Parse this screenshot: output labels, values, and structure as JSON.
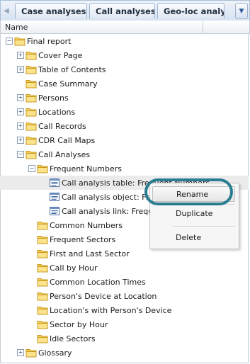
{
  "tabs": [
    {
      "label": "Case analyses"
    },
    {
      "label": "Call analyses"
    },
    {
      "label": "Geo-loc analyses"
    }
  ],
  "column_header": {
    "name": "Name"
  },
  "tree": [
    {
      "label": "Final report",
      "type": "folder",
      "depth": 0,
      "expander": "-"
    },
    {
      "label": "Cover Page",
      "type": "folder",
      "depth": 1,
      "expander": "+"
    },
    {
      "label": "Table of Contents",
      "type": "folder",
      "depth": 1,
      "expander": "+"
    },
    {
      "label": "Case Summary",
      "type": "folder",
      "depth": 1,
      "expander": ""
    },
    {
      "label": "Persons",
      "type": "folder",
      "depth": 1,
      "expander": "+"
    },
    {
      "label": "Locations",
      "type": "folder",
      "depth": 1,
      "expander": "+"
    },
    {
      "label": "Call Records",
      "type": "folder",
      "depth": 1,
      "expander": "+"
    },
    {
      "label": "CDR Call Maps",
      "type": "folder",
      "depth": 1,
      "expander": "+"
    },
    {
      "label": "Call Analyses",
      "type": "folder",
      "depth": 1,
      "expander": "-"
    },
    {
      "label": "Frequent Numbers",
      "type": "folder",
      "depth": 2,
      "expander": "-"
    },
    {
      "label": "Call analysis table: Frequent Numbers",
      "type": "doc",
      "depth": 3,
      "expander": "",
      "selected": true
    },
    {
      "label": "Call analysis object: Frequent Numbers",
      "type": "doc",
      "depth": 3,
      "expander": ""
    },
    {
      "label": "Call analysis link: Frequent Numbers",
      "type": "doc",
      "depth": 3,
      "expander": ""
    },
    {
      "label": "Common Numbers",
      "type": "folder",
      "depth": 2,
      "expander": ""
    },
    {
      "label": "Frequent Sectors",
      "type": "folder",
      "depth": 2,
      "expander": ""
    },
    {
      "label": "First and Last Sector",
      "type": "folder",
      "depth": 2,
      "expander": ""
    },
    {
      "label": "Call by Hour",
      "type": "folder",
      "depth": 2,
      "expander": ""
    },
    {
      "label": "Common Location Times",
      "type": "folder",
      "depth": 2,
      "expander": ""
    },
    {
      "label": "Person's Device at Location",
      "type": "folder",
      "depth": 2,
      "expander": ""
    },
    {
      "label": "Location's with Person's Device",
      "type": "folder",
      "depth": 2,
      "expander": ""
    },
    {
      "label": "Sector by Hour",
      "type": "folder",
      "depth": 2,
      "expander": ""
    },
    {
      "label": "Idle Sectors",
      "type": "folder",
      "depth": 2,
      "expander": ""
    },
    {
      "label": "Glossary",
      "type": "folder",
      "depth": 1,
      "expander": "+"
    }
  ],
  "context_menu": {
    "rename": "Rename",
    "duplicate": "Duplicate",
    "delete": "Delete"
  },
  "colors": {
    "highlight_ring": "#2a7d90",
    "folder": "#f2c94c",
    "selected_row": "#ebebeb"
  }
}
